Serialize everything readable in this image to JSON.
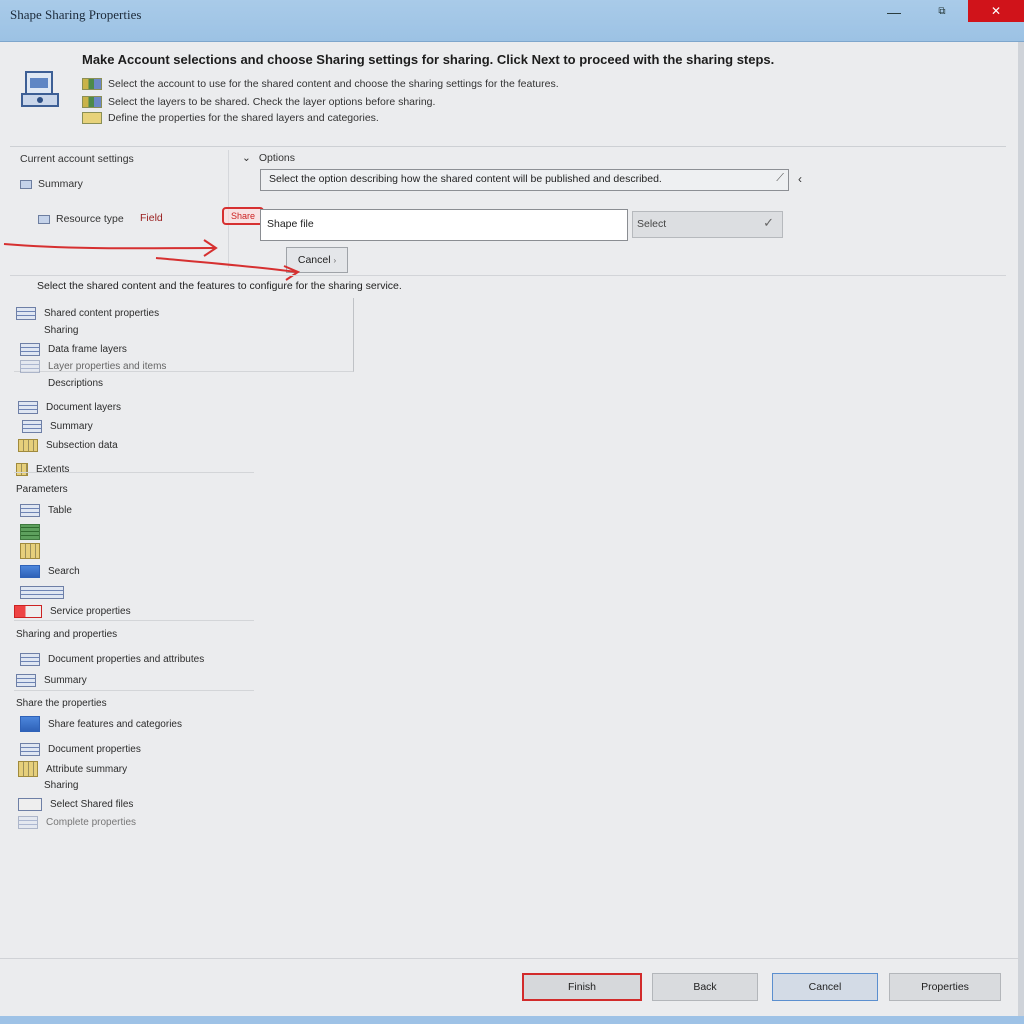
{
  "window": {
    "title": "Shape Sharing Properties",
    "minimize_glyph": "—",
    "maximize_glyph": "⧉",
    "close_glyph": "✕"
  },
  "header": {
    "icon": "wizard-icon",
    "title": "Make Account selections and choose Sharing settings for sharing. Click Next to proceed with the sharing steps.",
    "lines": [
      "Select the account to use for the shared content and choose the sharing settings for the features.",
      "Select the layers to be shared. Check the layer options before sharing.",
      "Define the properties for the shared layers and categories."
    ]
  },
  "form": {
    "account_label": "Current account settings",
    "summary_label": "Summary",
    "resource_label": "Resource type",
    "marker_text": "Share",
    "field_hint": "Field",
    "options_label": "Options",
    "dropdown_value": "Select the option describing how the shared content will be published and described.",
    "text_value": "Shape file",
    "browse_label": "Select",
    "small_button": "Cancel"
  },
  "list": {
    "header": "Select the shared content and the features to configure for the sharing service.",
    "top_items": [
      {
        "label": "Shared content properties",
        "icon": "table-icon"
      },
      {
        "label": "Sharing",
        "icon": "none"
      },
      {
        "label": "Data frame layers",
        "icon": "table-icon"
      },
      {
        "label": "Layer properties and items",
        "icon": "table-icon"
      },
      {
        "label": "Descriptions",
        "icon": "none"
      },
      {
        "label": "Document layers",
        "icon": "table-icon"
      },
      {
        "label": "Summary",
        "icon": "table-icon"
      },
      {
        "label": "Subsection data",
        "icon": "table-icon"
      },
      {
        "label": "Extents",
        "icon": "gold-icon"
      }
    ],
    "group1_label": "Parameters",
    "group1_items": [
      {
        "label": "Table",
        "icon": "table-icon"
      },
      {
        "label": "",
        "icon": "green-icon"
      },
      {
        "label": "",
        "icon": "gold-icon"
      },
      {
        "label": "Search",
        "icon": "blue-icon"
      },
      {
        "label": "",
        "icon": "table-icon"
      },
      {
        "label": "Service properties",
        "icon": "red-icon"
      }
    ],
    "group2_label": "Sharing and properties",
    "group2_items": [
      {
        "label": "Document properties and attributes",
        "icon": "table-icon"
      },
      {
        "label": "Summary",
        "icon": "table-icon"
      }
    ],
    "group3_label": "Share the properties",
    "group3_items": [
      {
        "label": "Share features and categories",
        "icon": "table-icon"
      },
      {
        "label": "Document properties",
        "icon": "table-icon"
      },
      {
        "label": "Attribute summary",
        "icon": "gold-icon"
      },
      {
        "label": "Sharing",
        "icon": "none"
      },
      {
        "label": "Select Shared files",
        "icon": "none"
      },
      {
        "label": "Complete properties",
        "icon": "table-icon"
      }
    ]
  },
  "footer": {
    "next": "Finish",
    "back": "Back",
    "cancel": "Cancel",
    "help": "Properties"
  },
  "colors": {
    "accent": "#d22b2b",
    "titlebar": "#a9cbe9",
    "close": "#d0131a"
  }
}
